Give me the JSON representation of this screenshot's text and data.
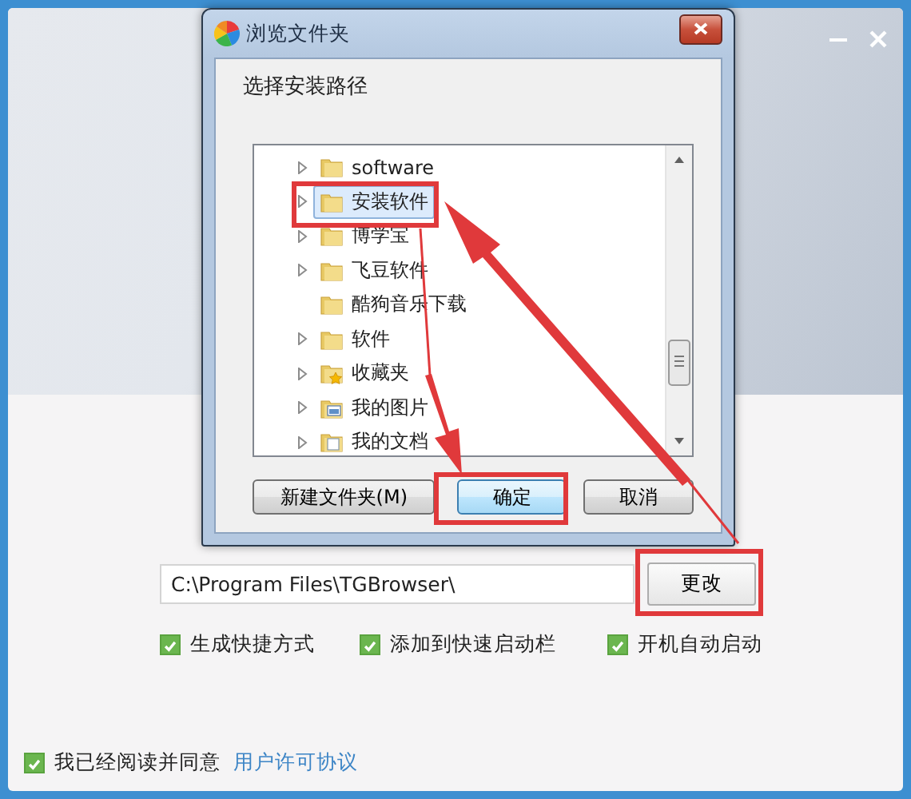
{
  "dialog": {
    "title": "浏览文件夹",
    "prompt": "选择安装路径",
    "tree": [
      {
        "label": "software",
        "kind": "folder",
        "expandable": true,
        "selected": false
      },
      {
        "label": "安装软件",
        "kind": "folder",
        "expandable": true,
        "selected": true
      },
      {
        "label": "博学宝",
        "kind": "folder",
        "expandable": true,
        "selected": false
      },
      {
        "label": "飞豆软件",
        "kind": "folder",
        "expandable": true,
        "selected": false
      },
      {
        "label": "酷狗音乐下载",
        "kind": "folder",
        "expandable": false,
        "selected": false
      },
      {
        "label": "软件",
        "kind": "folder",
        "expandable": true,
        "selected": false
      },
      {
        "label": "收藏夹",
        "kind": "favorites",
        "expandable": true,
        "selected": false
      },
      {
        "label": "我的图片",
        "kind": "pictures",
        "expandable": true,
        "selected": false
      },
      {
        "label": "我的文档",
        "kind": "documents",
        "expandable": true,
        "selected": false
      }
    ],
    "buttons": [
      {
        "label": "新建文件夹(M)",
        "default": false
      },
      {
        "label": "确定",
        "default": true
      },
      {
        "label": "取消",
        "default": false
      }
    ]
  },
  "install_path": {
    "value": "C:\\Program Files\\TGBrowser\\"
  },
  "change_button": "更改",
  "options": [
    {
      "label": "生成快捷方式",
      "checked": true
    },
    {
      "label": "添加到快速启动栏",
      "checked": true
    },
    {
      "label": "开机自动启动",
      "checked": true
    }
  ],
  "agreement": {
    "checked": true,
    "text": "我已经阅读并同意",
    "link": "用户许可协议"
  }
}
